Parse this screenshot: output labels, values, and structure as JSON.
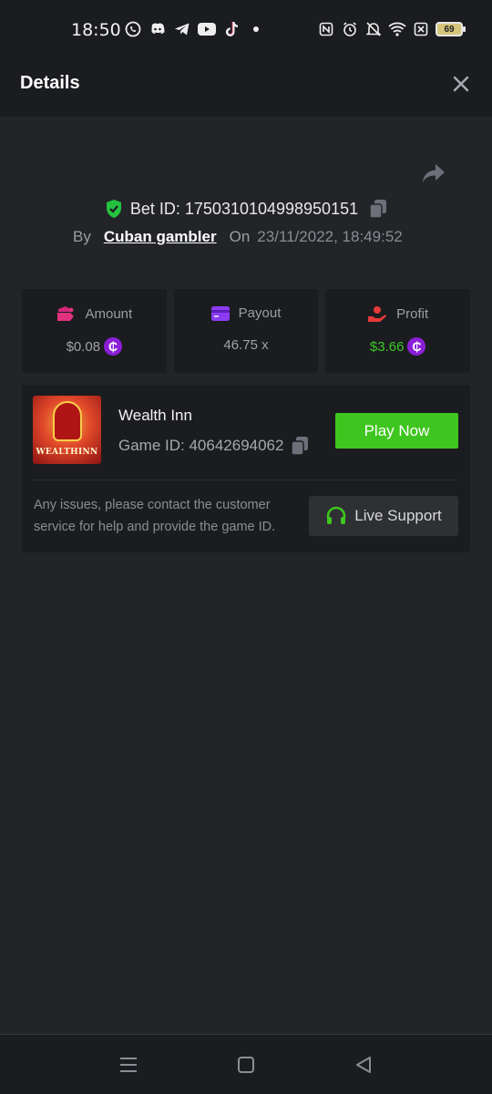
{
  "status_bar": {
    "time": "18:50",
    "battery": "69",
    "app_icons": [
      "whatsapp-icon",
      "discord-icon",
      "telegram-icon",
      "youtube-icon",
      "tiktok-icon",
      "dot-icon"
    ],
    "system_icons": [
      "nfc-icon",
      "alarm-icon",
      "mute-icon",
      "wifi-icon",
      "sim-off-icon",
      "battery-icon"
    ]
  },
  "header": {
    "title": "Details",
    "close_icon": "close-icon"
  },
  "bet": {
    "id_text": "Bet ID: 1750310104998950151",
    "by_label": "By",
    "user": "Cuban gambler",
    "on_label": "On",
    "date": "23/11/2022, 18:49:52"
  },
  "stats": {
    "amount_label": "Amount",
    "amount_value": "$0.08",
    "payout_label": "Payout",
    "payout_value": "46.75 x",
    "profit_label": "Profit",
    "profit_value": "$3.66",
    "coin_symbol": "₵"
  },
  "game": {
    "name": "Wealth Inn",
    "id_text": "Game ID: 40642694062",
    "thumb_label": "WEALTHINN",
    "play_label": "Play Now",
    "help_text": "Any issues, please contact the customer service for help and provide the game ID.",
    "support_label": "Live Support"
  },
  "colors": {
    "background": "#232428",
    "panel": "#1b1c1f",
    "green": "#3fc51f",
    "coin_purple": "#8a1fd6",
    "shield_green": "#25c23f"
  }
}
